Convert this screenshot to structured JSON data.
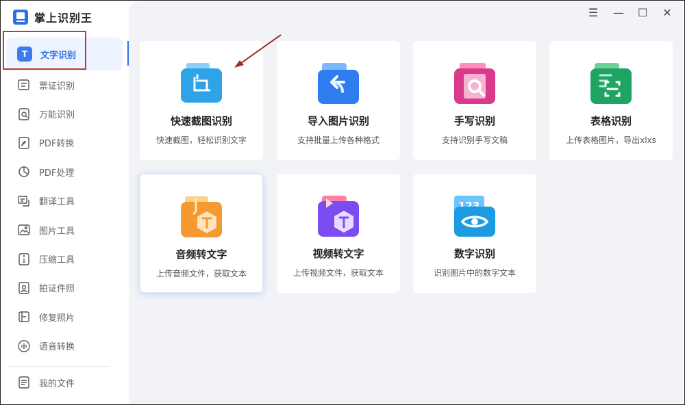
{
  "app": {
    "title": "掌上识别王"
  },
  "sidebar": {
    "items": [
      {
        "label": "文字识别",
        "icon": "text-recognition-icon",
        "active": true
      },
      {
        "label": "票证识别",
        "icon": "ticket-icon"
      },
      {
        "label": "万能识别",
        "icon": "universal-scan-icon"
      },
      {
        "label": "PDF转换",
        "icon": "pdf-convert-icon"
      },
      {
        "label": "PDF处理",
        "icon": "pdf-process-icon"
      },
      {
        "label": "翻译工具",
        "icon": "translate-icon"
      },
      {
        "label": "图片工具",
        "icon": "image-tool-icon"
      },
      {
        "label": "压缩工具",
        "icon": "compress-icon"
      },
      {
        "label": "拍证件照",
        "icon": "id-photo-icon"
      },
      {
        "label": "修复照片",
        "icon": "repair-photo-icon"
      },
      {
        "label": "语音转换",
        "icon": "voice-convert-icon"
      }
    ],
    "footer": {
      "label": "我的文件",
      "icon": "my-files-icon"
    }
  },
  "window_controls": {
    "menu": "☰",
    "minimize": "—",
    "maximize": "☐",
    "close": "✕"
  },
  "cards": [
    {
      "title": "快速截图识别",
      "desc": "快速截图，轻松识别文字",
      "icon": "screenshot-crop-icon"
    },
    {
      "title": "导入图片识别",
      "desc": "支持批量上传各种格式",
      "icon": "import-image-icon"
    },
    {
      "title": "手写识别",
      "desc": "支持识别手写文稿",
      "icon": "handwriting-icon"
    },
    {
      "title": "表格识别",
      "desc": "上传表格图片，导出xlxs",
      "icon": "table-icon"
    },
    {
      "title": "音频转文字",
      "desc": "上传音频文件，获取文本",
      "icon": "audio-to-text-icon"
    },
    {
      "title": "视频转文字",
      "desc": "上传视频文件，获取文本",
      "icon": "video-to-text-icon"
    },
    {
      "title": "数字识别",
      "desc": "识别图片中的数字文本",
      "icon": "number-recognition-icon",
      "glyph": "123"
    }
  ],
  "colors": {
    "accent": "#2f6fe4",
    "highlight_box": "#c0392b",
    "arrow": "#a02c24"
  }
}
